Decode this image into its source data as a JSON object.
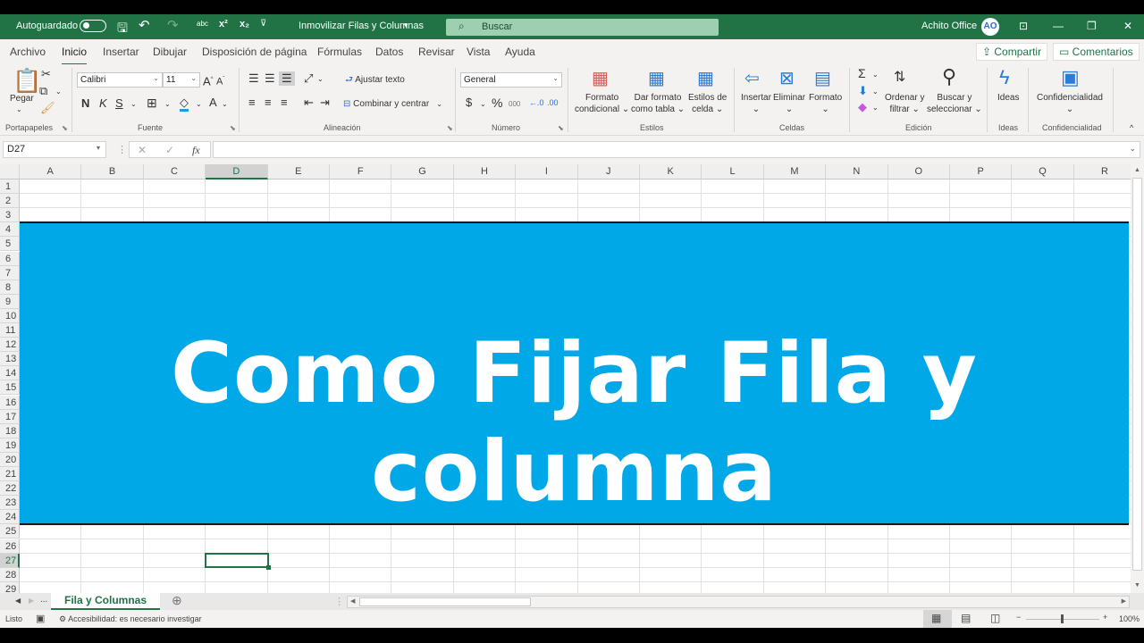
{
  "titlebar": {
    "autosave_label": "Autoguardado",
    "autosave_state": "off",
    "doc_title": "Inmovilizar Filas y Columnas",
    "doc_title_dropdown": "⌄",
    "search_placeholder": "Buscar",
    "user_name": "Achito Office",
    "avatar_initials": "AO",
    "icons": {
      "save": "💾",
      "undo": "↶",
      "redo": "↷",
      "spelling": "abc",
      "superscript": "x²",
      "subscript": "x₂",
      "customize": "⊽"
    },
    "window_buttons": {
      "ribbon_display": "⊡",
      "minimize": "—",
      "restore": "❐",
      "close": "✕"
    }
  },
  "menu": {
    "tabs": [
      "Archivo",
      "Inicio",
      "Insertar",
      "Dibujar",
      "Disposición de página",
      "Fórmulas",
      "Datos",
      "Revisar",
      "Vista",
      "Ayuda"
    ],
    "active_tab": "Inicio",
    "share_label": "Compartir",
    "comments_label": "Comentarios"
  },
  "ribbon": {
    "clipboard": {
      "paste": "Pegar",
      "group": "Portapapeles"
    },
    "font": {
      "name": "Calibri",
      "size": "11",
      "bold": "N",
      "italic": "K",
      "underline": "S",
      "grow": "A^",
      "shrink": "Aˇ",
      "font_color": "A",
      "group": "Fuente"
    },
    "alignment": {
      "wrap": "Ajustar texto",
      "merge": "Combinar y centrar",
      "group": "Alineación"
    },
    "number": {
      "format": "General",
      "currency": "$",
      "percent": "%",
      "thousands": "000",
      "inc_dec": "←.0",
      "dec_dec": ".00→",
      "group": "Número"
    },
    "styles": {
      "conditional_line1": "Formato",
      "conditional_line2": "condicional",
      "table_line1": "Dar formato",
      "table_line2": "como tabla",
      "cell_line1": "Estilos de",
      "cell_line2": "celda",
      "group": "Estilos"
    },
    "cells": {
      "insert": "Insertar",
      "delete": "Eliminar",
      "format": "Formato",
      "group": "Celdas"
    },
    "editing": {
      "sum": "Σ",
      "sort_line1": "Ordenar y",
      "sort_line2": "filtrar",
      "find_line1": "Buscar y",
      "find_line2": "seleccionar",
      "group": "Edición"
    },
    "ideas": {
      "label": "Ideas",
      "group": "Ideas"
    },
    "sensitivity": {
      "label": "Confidencialidad",
      "group": "Confidencialidad"
    }
  },
  "formula_bar": {
    "name_box": "D27",
    "cancel": "✕",
    "enter": "✓",
    "fx": "fx",
    "formula": ""
  },
  "grid": {
    "columns": [
      "A",
      "B",
      "C",
      "D",
      "E",
      "F",
      "G",
      "H",
      "I",
      "J",
      "K",
      "L",
      "M",
      "N",
      "O",
      "P",
      "Q",
      "R"
    ],
    "selected_column": "D",
    "rows": [
      "1",
      "2",
      "3",
      "4",
      "5",
      "6",
      "7",
      "8",
      "9",
      "10",
      "11",
      "12",
      "13",
      "14",
      "15",
      "16",
      "17",
      "18",
      "19",
      "20",
      "21",
      "22",
      "23",
      "24",
      "25",
      "26",
      "27",
      "28",
      "29"
    ],
    "selected_row": "27",
    "banner_text": "Como Fijar Fila y columna",
    "banner_color": "#00a8e8"
  },
  "sheets": {
    "tabs": [
      "Fila y Columnas"
    ],
    "active": "Fila y Columnas",
    "more": "...",
    "add": "⊕"
  },
  "status": {
    "ready": "Listo",
    "accessibility": "Accesibilidad: es necesario investigar",
    "zoom": "100%",
    "zoom_minus": "−",
    "zoom_plus": "+"
  }
}
